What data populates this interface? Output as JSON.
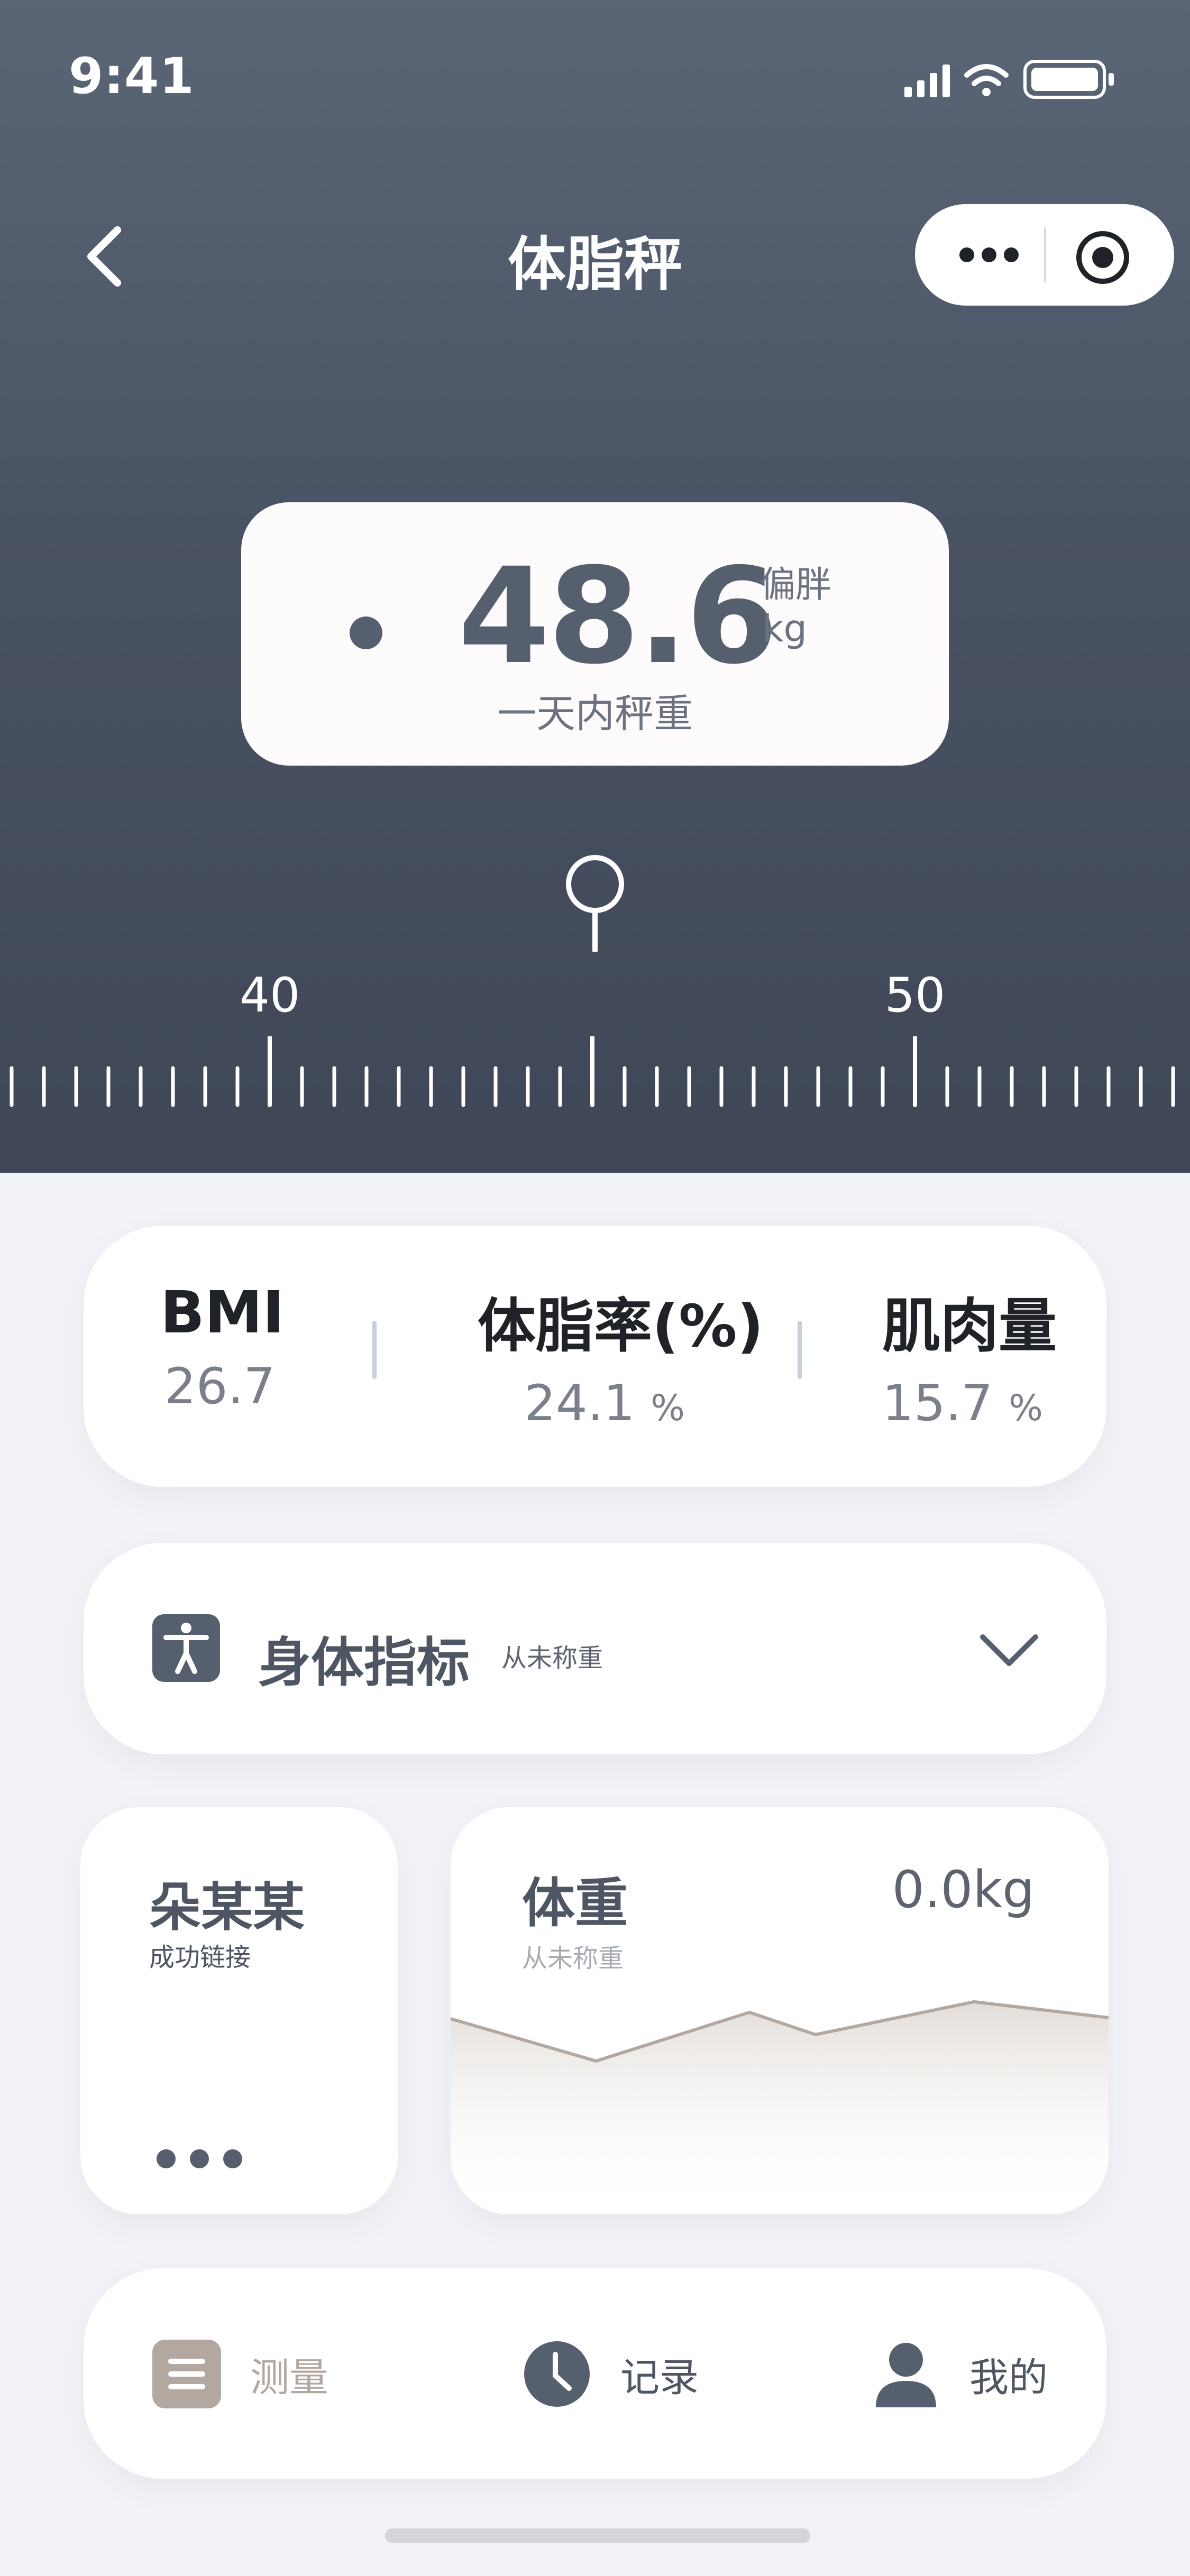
{
  "status_bar": {
    "time": "9:41"
  },
  "nav": {
    "title": "体脂秤"
  },
  "weight": {
    "value": "48.6",
    "tag": "偏胖",
    "unit": "kg",
    "subtitle": "一天内秤重"
  },
  "ruler": {
    "labels": [
      "40",
      "50"
    ],
    "current_value": 45
  },
  "stats": [
    {
      "label": "BMI",
      "value": "26.7",
      "unit": ""
    },
    {
      "label": "体脂率(%)",
      "value": "24.1",
      "unit": "%"
    },
    {
      "label": "肌肉量",
      "value": "15.7",
      "unit": "%"
    }
  ],
  "indicator": {
    "title": "身体指标",
    "subtitle": "从未称重"
  },
  "user": {
    "name": "朵某某",
    "status": "成功链接"
  },
  "weight_card": {
    "title": "体重",
    "value": "0.0kg",
    "subtitle": "从未称重"
  },
  "tabs": [
    {
      "label": "测量",
      "icon": "list-icon"
    },
    {
      "label": "记录",
      "icon": "clock-icon"
    },
    {
      "label": "我的",
      "icon": "person-icon"
    }
  ],
  "colors": {
    "header_top": "#5a6576",
    "header_bottom": "#3f4757",
    "primary_gray": "#565f6e",
    "accent_tan": "#b3a8a0",
    "background": "#f1f3f7"
  }
}
